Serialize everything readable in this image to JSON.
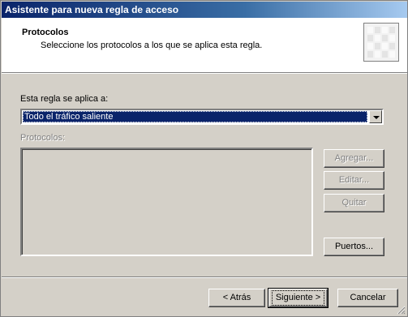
{
  "window": {
    "title": "Asistente para nueva regla de acceso"
  },
  "header": {
    "title": "Protocolos",
    "subtitle": "Seleccione los protocolos a los que se aplica esta regla.",
    "icon": "wizard-icon"
  },
  "applies_to": {
    "label": "Esta regla se aplica a:",
    "selected": "Todo el tráfico saliente"
  },
  "protocols": {
    "label": "Protocolos:",
    "items": []
  },
  "side_buttons": {
    "add": "Agregar...",
    "edit": "Editar...",
    "remove": "Quitar",
    "ports": "Puertos..."
  },
  "footer": {
    "back": "< Atrás",
    "next": "Siguiente >",
    "cancel": "Cancelar"
  },
  "colors": {
    "titlebar": "#0a246a",
    "face": "#d4d0c8",
    "selection": "#0a246a"
  }
}
